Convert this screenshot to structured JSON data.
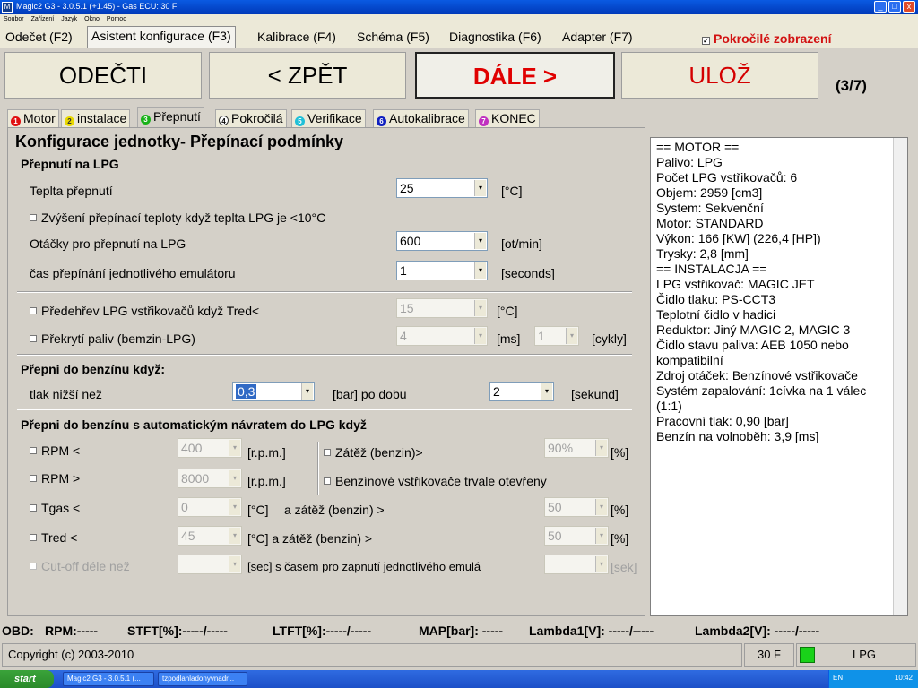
{
  "window": {
    "title": "Magic2 G3 - 3.0.5.1 (+1.45) - Gas ECU: 30 F",
    "icon_letter": "M",
    "controls": [
      "_",
      "□",
      "x"
    ]
  },
  "menu": [
    "Soubor",
    "Zařízení",
    "Jazyk",
    "Okno",
    "Pomoc"
  ],
  "main_tabs": [
    "Odečet (F2)",
    "Asistent konfigurace (F3)",
    "Kalibrace (F4)",
    "Schéma (F5)",
    "Diagnostika (F6)",
    "Adapter (F7)"
  ],
  "advanced_view": {
    "label": "Pokročilé zobrazení",
    "checked": true
  },
  "buttons": {
    "read": "ODEČTI",
    "back": "< ZPĚT",
    "next": "DÁLE >",
    "save": "ULOŽ"
  },
  "step": "(3/7)",
  "subtabs": [
    {
      "num": "1",
      "label": "Motor",
      "color": "#e01010"
    },
    {
      "num": "2",
      "label": "instalace",
      "color": "#e8d800"
    },
    {
      "num": "3",
      "label": "Přepnutí",
      "color": "#19b219"
    },
    {
      "num": "4",
      "label": "Pokročilá",
      "color": "#ffffff"
    },
    {
      "num": "5",
      "label": "Verifikace",
      "color": "#20c0d8"
    },
    {
      "num": "6",
      "label": "Autokalibrace",
      "color": "#1020c0"
    },
    {
      "num": "7",
      "label": "KONEC",
      "color": "#c030c0"
    }
  ],
  "panel": {
    "title": "Konfigurace jednotky- Přepínací podmínky",
    "lpg_section": "Přepnutí na LPG",
    "switch_temp": {
      "label": "Teplta přepnutí",
      "value": "25",
      "unit": "[°C]"
    },
    "raise_temp": "Zvýšení přepínací teploty když teplta LPG je <10°C",
    "rpm_switch": {
      "label": "Otáčky pro přepnutí na LPG",
      "value": "600",
      "unit": "[ot/min]"
    },
    "emu_time": {
      "label": "čas přepínání jednotlivého emulátoru",
      "value": "1",
      "unit": "[seconds]"
    },
    "preheat": {
      "label": "Předehřev LPG vstřikovačů když Tred<",
      "value": "15",
      "unit": "[°C]"
    },
    "overlap": {
      "label": "Překrytí paliv (bemzin-LPG)",
      "value": "4",
      "unit": "[ms]",
      "value2": "1",
      "unit2": "[cykly]"
    },
    "petrol_section": "Přepni do benzínu když:",
    "pressure": {
      "label": "tlak nižší než",
      "value": "0,3",
      "unit": "[bar] po dobu",
      "value2": "2",
      "unit2": "[sekund]"
    },
    "auto_section": "Přepni do benzínu s automatickým návratem do LPG když",
    "rpm_lt": {
      "label": "RPM <",
      "value": "400",
      "unit": "[r.p.m.]"
    },
    "rpm_gt": {
      "label": "RPM >",
      "value": "8000",
      "unit": "[r.p.m.]"
    },
    "tgas": {
      "label": "Tgas <",
      "value": "0",
      "unit": "[°C]",
      "suffix": "a zátěž (benzin) >",
      "value2": "50",
      "unit2": "[%]"
    },
    "tred": {
      "label": "Tred <",
      "value": "45",
      "unit": "[°C] a zátěž (benzin) >",
      "value2": "50",
      "unit2": "[%]"
    },
    "cutoff": {
      "label": "Cut-off déle než",
      "unit": "[sec] s časem pro zapnutí jednotlivého emulá",
      "unit2": "[sek]"
    },
    "load": {
      "label": "Zátěž (benzin)>",
      "value": "90%",
      "unit": "[%]"
    },
    "injectors_open": "Benzínové vstřikovače trvale otevřeny"
  },
  "info_lines": [
    "== MOTOR ==",
    "Palivo: LPG",
    "Počet LPG vstřikovačů: 6",
    "Objem: 2959 [cm3]",
    "System: Sekvenční",
    "Motor: STANDARD",
    "Výkon: 166 [KW] (226,4 [HP])",
    "Trysky: 2,8 [mm]",
    "== INSTALACJA ==",
    "LPG vstřikovač: MAGIC JET",
    "Čidlo tlaku: PS-CCT3",
    "Teplotní čidlo v hadici",
    "Reduktor: Jiný MAGIC 2, MAGIC 3",
    "Čidlo stavu paliva: AEB 1050 nebo",
    "kompatibilní",
    "Zdroj otáček: Benzínové vstřikovače",
    "Systém zapalování: 1cívka na 1 válec",
    "(1:1)",
    "Pracovní tlak: 0,90 [bar]",
    "Benzín na volnoběh: 3,9 [ms]"
  ],
  "obd": {
    "obd": "OBD:",
    "rpm": "RPM:-----",
    "stft": "STFT[%]:-----/-----",
    "ltft": "LTFT[%]:-----/-----",
    "map": "MAP[bar]: -----",
    "l1": "Lambda1[V]: -----/-----",
    "l2": "Lambda2[V]: -----/-----"
  },
  "status": {
    "copyright": "Copyright (c) 2003-2010",
    "ecu": "30 F",
    "fuel": "LPG",
    "indicator_color": "#19d219"
  },
  "taskbar": {
    "start": "start",
    "items": [
      "Magic2 G3 - 3.0.5.1 (...",
      "tzpodlahladonyvnadr..."
    ],
    "lang": "EN",
    "clock": "10:42"
  }
}
